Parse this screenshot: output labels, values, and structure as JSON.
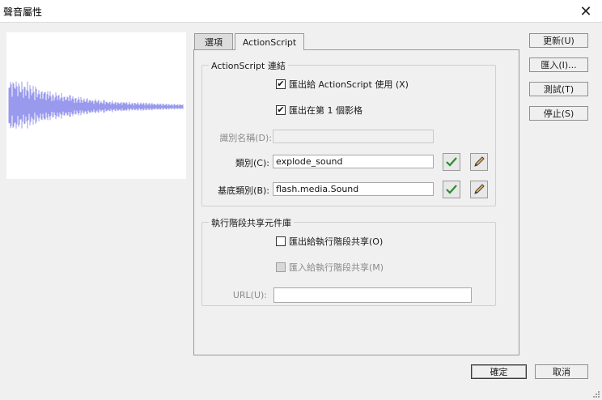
{
  "window": {
    "title": "聲音屬性"
  },
  "tabs": {
    "options": "選項",
    "actionscript": "ActionScript"
  },
  "linkage": {
    "legend": "ActionScript 連結",
    "export_as": {
      "label": "匯出給 ActionScript 使用 (X)",
      "checked": true
    },
    "export_frame1": {
      "label": "匯出在第 1 個影格",
      "checked": true
    },
    "identifier": {
      "label": "識別名稱(D):",
      "value": ""
    },
    "class": {
      "label": "類別(C):",
      "value": "explode_sound"
    },
    "base_class": {
      "label": "基底類別(B):",
      "value": "flash.media.Sound"
    }
  },
  "sharing": {
    "legend": "執行階段共享元件庫",
    "export_runtime": {
      "label": "匯出給執行階段共享(O)",
      "checked": false
    },
    "import_runtime": {
      "label": "匯入給執行階段共享(M)",
      "checked": false
    },
    "url": {
      "label": "URL(U):",
      "value": ""
    }
  },
  "side_buttons": {
    "update": "更新(U)",
    "import": "匯入(I)...",
    "test": "測試(T)",
    "stop": "停止(S)"
  },
  "footer": {
    "ok": "確定",
    "cancel": "取消"
  },
  "colors": {
    "waveform": "#9999ee",
    "check_green": "#2e8b2e"
  }
}
